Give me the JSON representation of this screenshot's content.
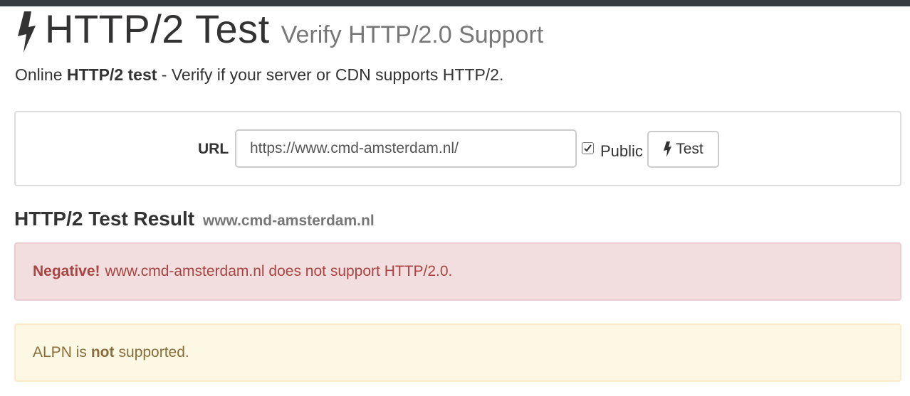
{
  "header": {
    "title": "HTTP/2 Test",
    "subtitle": "Verify HTTP/2.0 Support"
  },
  "lead": {
    "prefix": "Online",
    "bold": "HTTP/2 test",
    "suffix": "- Verify if your server or CDN supports HTTP/2."
  },
  "form": {
    "url_label": "URL",
    "url_value": "https://www.cmd-amsterdam.nl/",
    "public_label": "Public",
    "public_checked": true,
    "test_button_label": "Test",
    "icon": "bolt-icon"
  },
  "result": {
    "heading": "HTTP/2 Test Result",
    "domain": "www.cmd-amsterdam.nl"
  },
  "alerts": {
    "negative_label": "Negative!",
    "negative_text": "www.cmd-amsterdam.nl does not support HTTP/2.0.",
    "alpn_prefix": "ALPN is",
    "alpn_bold": "not",
    "alpn_suffix": "supported."
  },
  "colors": {
    "topbar": "#373c40",
    "danger_bg": "#f2dede",
    "danger_text": "#a94442",
    "warning_bg": "#fcf8e3",
    "warning_text": "#8a6d3b"
  }
}
